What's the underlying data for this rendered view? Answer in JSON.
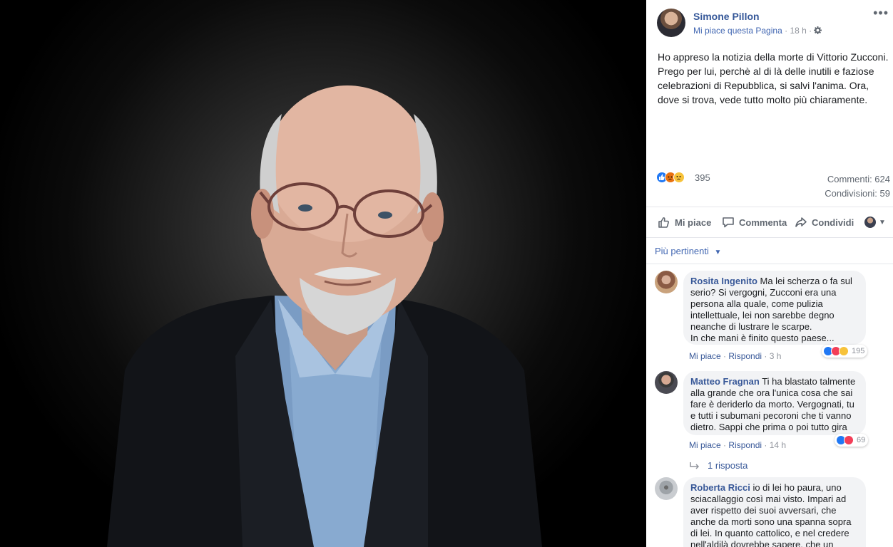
{
  "post": {
    "author": "Simone Pillon",
    "page_like": "Mi piace questa Pagina",
    "time": "18 h",
    "text": "Ho appreso la notizia della morte di Vittorio Zucconi. Prego per lui, perchè al di là delle inutili e faziose celebrazioni di Repubblica, si salvi l'anima. Ora, dove si trova, vede tutto molto più chiaramente.",
    "reactions_count": "395",
    "comments_count": "Commenti: 624",
    "shares_count": "Condivisioni: 59",
    "reaction_types": [
      "like-reaction-icon",
      "angry-reaction-icon",
      "sad-reaction-icon"
    ]
  },
  "actions": {
    "like": "Mi piace",
    "comment": "Commenta",
    "share": "Condividi"
  },
  "filter": {
    "label": "Più pertinenti"
  },
  "comments": [
    {
      "name": "Rosita Ingenito",
      "text": "Ma lei scherza o fa sul serio? Si vergogni, Zucconi era una persona alla quale, come pulizia intellettuale, lei non sarebbe degno neanche di lustrare le scarpe.\nIn che mani è finito questo paese...",
      "like": "Mi piace",
      "reply": "Rispondi",
      "time": "3 h",
      "reactions": "195"
    },
    {
      "name": "Matteo Fragnan",
      "text": "Ti ha blastato talmente alla grande che ora l'unica cosa che sai fare è deriderlo da morto. Vergognati, tu e tutti i subumani pecoroni che ti vanno dietro. Sappi che prima o poi tutto gira",
      "like": "Mi piace",
      "reply": "Rispondi",
      "time": "14 h",
      "reactions": "69",
      "replies": "1 risposta"
    },
    {
      "name": "Roberta Ricci",
      "text": "io di lei ho paura, uno sciacallaggio così mai visto. Impari ad aver rispetto dei suoi avversari, che anche da morti sono una spanna sopra di lei. In quanto cattolico, e nel credere nell'aldilà dovrebbe sapere, che un giorno ci"
    }
  ],
  "colors": {
    "link_blue": "#365899",
    "meta_gray": "#90949c",
    "like_blue": "#2078f4",
    "love_red": "#f33e58",
    "haha_yellow": "#f7c23a",
    "angry_orange": "#e9710f"
  }
}
